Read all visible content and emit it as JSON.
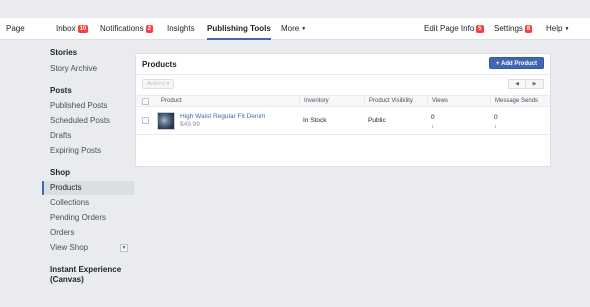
{
  "topnav": {
    "page": "Page",
    "inbox": "Inbox",
    "inbox_count": "10",
    "notifications": "Notifications",
    "notifications_count": "2",
    "insights": "Insights",
    "publishing_tools": "Publishing Tools",
    "more": "More",
    "edit_page_info": "Edit Page Info",
    "edit_page_info_count": "5",
    "settings": "Settings",
    "settings_count": "8",
    "help": "Help"
  },
  "sidebar": {
    "stories_heading": "Stories",
    "story_archive": "Story Archive",
    "posts_heading": "Posts",
    "published_posts": "Published Posts",
    "scheduled_posts": "Scheduled Posts",
    "drafts": "Drafts",
    "expiring_posts": "Expiring Posts",
    "shop_heading": "Shop",
    "products": "Products",
    "collections": "Collections",
    "pending_orders": "Pending Orders",
    "orders": "Orders",
    "view_shop": "View Shop",
    "instant_experience_heading": "Instant Experience (Canvas)"
  },
  "panel": {
    "title": "Products",
    "add_button": "+ Add Product",
    "actions_button": "Actions ▾",
    "pager_prev": "◀",
    "pager_next": "▶",
    "columns": [
      "Product",
      "Inventory",
      "Product Visibility",
      "Views",
      "Message Sends"
    ],
    "rows": [
      {
        "name": "High Waist Regular Fit Denim",
        "price": "$49.99",
        "inventory": "In Stock",
        "visibility": "Public",
        "views": "0",
        "message_sends": "0"
      }
    ]
  },
  "colors": {
    "accent": "#4267b2",
    "badge": "#fa3e3e",
    "background": "#e9ebee"
  }
}
